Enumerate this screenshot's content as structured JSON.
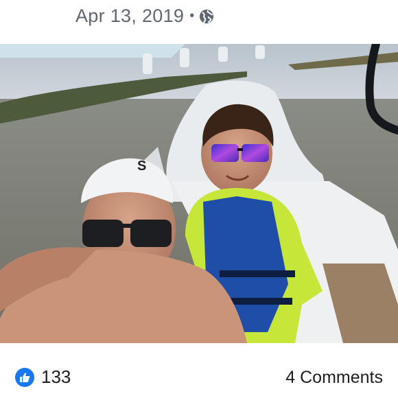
{
  "post": {
    "date": "Apr 13, 2019",
    "separator": "•",
    "privacy_icon": "globe-icon"
  },
  "photo": {
    "cap_logo": "S"
  },
  "reactions": {
    "like_icon": "thumbs-up-icon",
    "like_count": "133",
    "comments_label": "4 Comments"
  },
  "colors": {
    "like_blue": "#1877f2",
    "meta_gray": "#606770"
  }
}
